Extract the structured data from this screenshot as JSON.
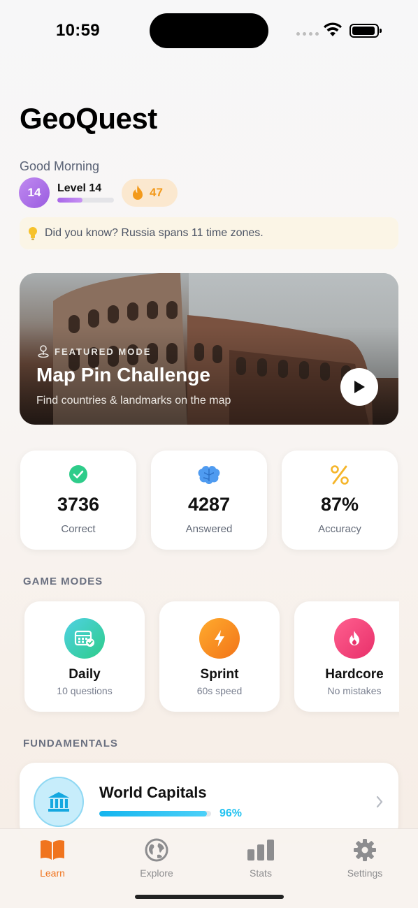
{
  "status_bar": {
    "time": "10:59"
  },
  "app_title": "GeoQuest",
  "greeting": "Good Morning",
  "level": {
    "badge": "14",
    "label": "Level 14",
    "progress_percent": 45
  },
  "streak": {
    "count": "47"
  },
  "tip": {
    "text": "Did you know? Russia spans 11 time zones."
  },
  "featured": {
    "tag": "FEATURED MODE",
    "title": "Map Pin Challenge",
    "subtitle": "Find countries & landmarks on the map"
  },
  "stats": [
    {
      "value": "3736",
      "label": "Correct",
      "icon": "check-circle-icon",
      "color": "#2ecc8a"
    },
    {
      "value": "4287",
      "label": "Answered",
      "icon": "brain-icon",
      "color": "#4f9bf0"
    },
    {
      "value": "87%",
      "label": "Accuracy",
      "icon": "percent-icon",
      "color": "#f5b52a"
    }
  ],
  "sections": {
    "game_modes": "GAME MODES",
    "fundamentals": "FUNDAMENTALS"
  },
  "modes": [
    {
      "name": "Daily",
      "sub": "10 questions",
      "icon": "calendar-icon"
    },
    {
      "name": "Sprint",
      "sub": "60s speed",
      "icon": "lightning-icon"
    },
    {
      "name": "Hardcore",
      "sub": "No mistakes",
      "icon": "flame-icon"
    }
  ],
  "fundamentals": [
    {
      "title": "World Capitals",
      "progress": "96%",
      "progress_value": 96,
      "icon": "bank-icon"
    }
  ],
  "tabs": [
    {
      "label": "Learn",
      "icon": "book-icon",
      "active": true
    },
    {
      "label": "Explore",
      "icon": "globe-icon",
      "active": false
    },
    {
      "label": "Stats",
      "icon": "bar-chart-icon",
      "active": false
    },
    {
      "label": "Settings",
      "icon": "gear-icon",
      "active": false
    }
  ],
  "colors": {
    "accent": "#f0741e",
    "level": "#a866e8",
    "streak": "#f39a1b",
    "capitals": "#22c2f0"
  }
}
